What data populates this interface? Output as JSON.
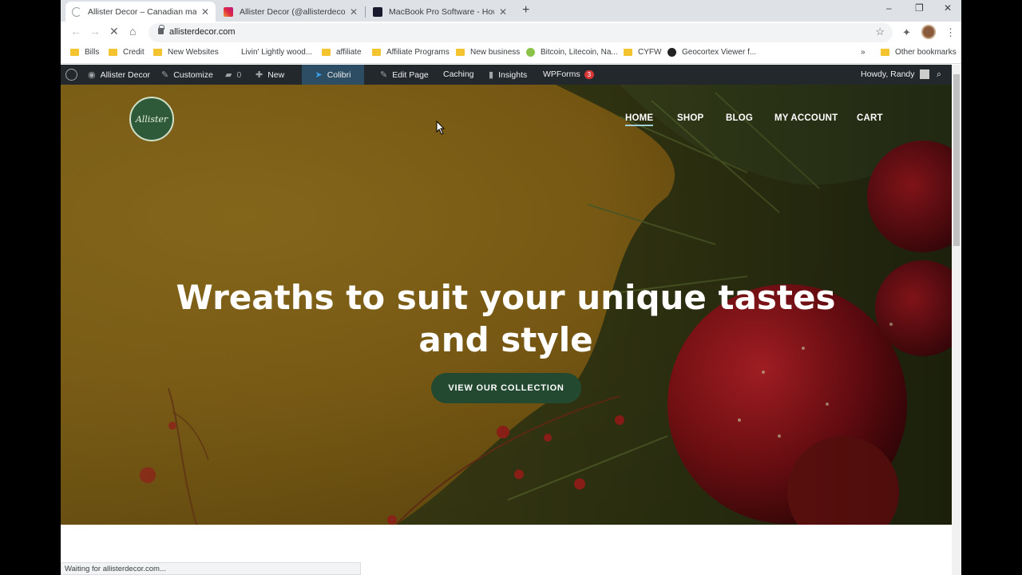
{
  "tabs": [
    {
      "title": "Allister Decor – Canadian made, ...",
      "active": true
    },
    {
      "title": "Allister Decor (@allisterdecor) • I..."
    },
    {
      "title": "MacBook Pro Software - How th..."
    }
  ],
  "toolbar": {
    "url": "allisterdecor.com"
  },
  "bookmarks": [
    "Bills",
    "Credit",
    "New Websites",
    "Livin' Lightly wood...",
    "affiliate",
    "Affiliate Programs",
    "New business",
    "Bitcoin, Litecoin, Na...",
    "CYFW",
    "Geocortex Viewer f...",
    "Other bookmarks"
  ],
  "adminbar": {
    "site": "Allister Decor",
    "customize": "Customize",
    "comments": "0",
    "new": "New",
    "colibri": "Colibri",
    "edit_page": "Edit Page",
    "caching": "Caching",
    "insights": "Insights",
    "wpforms": "WPForms",
    "wpforms_count": "3",
    "howdy": "Howdy, Randy"
  },
  "site": {
    "logo_text": "Allister",
    "nav": [
      "HOME",
      "SHOP",
      "BLOG",
      "MY ACCOUNT",
      "CART"
    ],
    "headline_line1": "Wreaths to suit your unique tastes",
    "headline_line2": "and style",
    "cta": "VIEW OUR COLLECTION"
  },
  "status": "Waiting for allisterdecor.com..."
}
